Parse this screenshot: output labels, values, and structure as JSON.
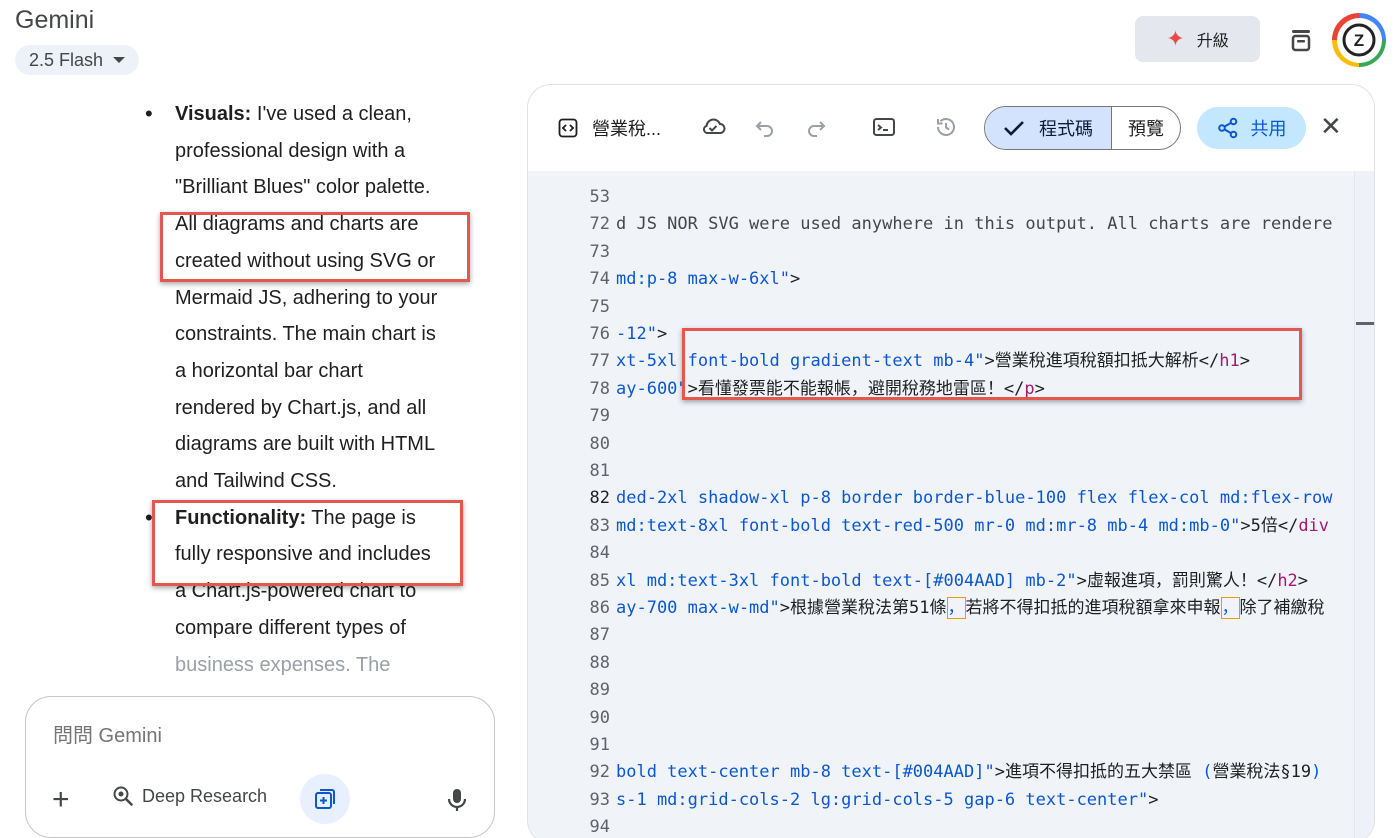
{
  "app": {
    "title": "Gemini",
    "model": "2.5 Flash"
  },
  "header": {
    "upgrade_label": "升級",
    "avatar_letter": "Z"
  },
  "chat": {
    "bullets": [
      {
        "label": "Visuals:",
        "lines": [
          " I've used a clean,",
          "professional design with a",
          "\"Brilliant Blues\" color palette.",
          "All diagrams and charts are",
          "created without using SVG or",
          "Mermaid JS, adhering to your",
          "constraints. The main chart is",
          "a horizontal bar chart",
          "rendered by Chart.js, and all",
          "diagrams are built with HTML",
          "and Tailwind CSS."
        ]
      },
      {
        "label": "Functionality:",
        "lines": [
          " The page is",
          "fully responsive and includes",
          "a Chart.js-powered chart to",
          "compare different types of",
          "business expenses. The"
        ]
      }
    ]
  },
  "prompt": {
    "placeholder": "問問 Gemini",
    "deep_research": "Deep Research"
  },
  "canvas": {
    "title": "營業稅...",
    "code_tab": "程式碼",
    "preview_tab": "預覽",
    "share": "共用",
    "lines": [
      {
        "n": "53",
        "parts": []
      },
      {
        "n": "72",
        "parts": [
          {
            "c": "dim",
            "t": "d JS NOR SVG were used anywhere in this output. All charts are rendere"
          }
        ]
      },
      {
        "n": "73",
        "parts": []
      },
      {
        "n": "74",
        "parts": [
          {
            "c": "str",
            "t": " md:p-8 max-w-6xl\""
          },
          {
            "c": "sym",
            "t": ">"
          }
        ]
      },
      {
        "n": "75",
        "parts": []
      },
      {
        "n": "76",
        "parts": [
          {
            "c": "str",
            "t": "-12\""
          },
          {
            "c": "sym",
            "t": ">"
          }
        ]
      },
      {
        "n": "77",
        "parts": [
          {
            "c": "str",
            "t": "xt-5xl font-bold gradient-text mb-4\""
          },
          {
            "c": "sym",
            "t": ">"
          },
          {
            "c": "txt",
            "t": "營業稅進項稅額扣抵大解析"
          },
          {
            "c": "sym",
            "t": "</"
          },
          {
            "c": "tag",
            "t": "h1"
          },
          {
            "c": "sym",
            "t": ">"
          }
        ]
      },
      {
        "n": "78",
        "parts": [
          {
            "c": "str",
            "t": "ay-600\""
          },
          {
            "c": "sym",
            "t": ">"
          },
          {
            "c": "txt",
            "t": "看懂發票能不能報帳，避開稅務地雷區！"
          },
          {
            "c": "sym",
            "t": "</"
          },
          {
            "c": "tag",
            "t": "p"
          },
          {
            "c": "sym",
            "t": ">"
          }
        ]
      },
      {
        "n": "79",
        "parts": []
      },
      {
        "n": "80",
        "parts": []
      },
      {
        "n": "81",
        "parts": []
      },
      {
        "n": "82",
        "active": true,
        "parts": [
          {
            "c": "str",
            "t": "ded-2xl shadow-xl p-8 border border-blue-100 flex flex-col md:flex-row"
          }
        ]
      },
      {
        "n": "83",
        "parts": [
          {
            "c": "str",
            "t": "md:text-8xl font-bold text-red-500 mr-0 md:mr-8 mb-4 md:mb-0\""
          },
          {
            "c": "sym",
            "t": ">"
          },
          {
            "c": "txt",
            "t": "5倍"
          },
          {
            "c": "sym",
            "t": "</"
          },
          {
            "c": "tag",
            "t": "div"
          }
        ]
      },
      {
        "n": "84",
        "parts": []
      },
      {
        "n": "85",
        "parts": [
          {
            "c": "str",
            "t": "xl md:text-3xl font-bold text-[#004AAD] mb-2\""
          },
          {
            "c": "sym",
            "t": ">"
          },
          {
            "c": "txt",
            "t": "虛報進項，罰則驚人！"
          },
          {
            "c": "sym",
            "t": "</"
          },
          {
            "c": "tag",
            "t": "h2"
          },
          {
            "c": "sym",
            "t": ">"
          }
        ]
      },
      {
        "n": "86",
        "parts": [
          {
            "c": "str",
            "t": "ay-700 max-w-md\""
          },
          {
            "c": "sym",
            "t": ">"
          },
          {
            "c": "txt",
            "t": "根據營業稅法第51條"
          },
          {
            "c": "mark",
            "t": "，"
          },
          {
            "c": "txt",
            "t": "若將不得扣抵的進項稅額拿來申報"
          },
          {
            "c": "mark",
            "t": "，"
          },
          {
            "c": "txt",
            "t": "除了補繳稅"
          }
        ]
      },
      {
        "n": "87",
        "parts": []
      },
      {
        "n": "88",
        "parts": []
      },
      {
        "n": "89",
        "parts": []
      },
      {
        "n": "90",
        "parts": []
      },
      {
        "n": "91",
        "parts": []
      },
      {
        "n": "92",
        "parts": [
          {
            "c": "str",
            "t": "bold text-center mb-8 text-[#004AAD]\""
          },
          {
            "c": "sym",
            "t": ">"
          },
          {
            "c": "txt",
            "t": "進項不得扣抵的五大禁區 "
          },
          {
            "c": "str",
            "t": "("
          },
          {
            "c": "txt",
            "t": "營業稅法§19"
          },
          {
            "c": "str",
            "t": ")"
          }
        ]
      },
      {
        "n": "93",
        "parts": [
          {
            "c": "str",
            "t": "s-1 md:grid-cols-2 lg:grid-cols-5 gap-6 text-center\""
          },
          {
            "c": "sym",
            "t": ">"
          }
        ]
      },
      {
        "n": "94",
        "parts": []
      }
    ]
  },
  "colors": {
    "accent": "#0b57d0",
    "highlight": "#e4574f",
    "code_bg": "#f0f4f9",
    "share_bg": "#c2e7ff"
  },
  "icons": [
    "chevron-down-icon",
    "sparkle-icon",
    "inbox-icon",
    "code-icon",
    "cloud-sync-icon",
    "undo-icon",
    "redo-icon",
    "terminal-icon",
    "history-icon",
    "check-icon",
    "share-icon",
    "close-icon",
    "plus-icon",
    "deep-research-icon",
    "image-add-icon",
    "mic-icon"
  ]
}
